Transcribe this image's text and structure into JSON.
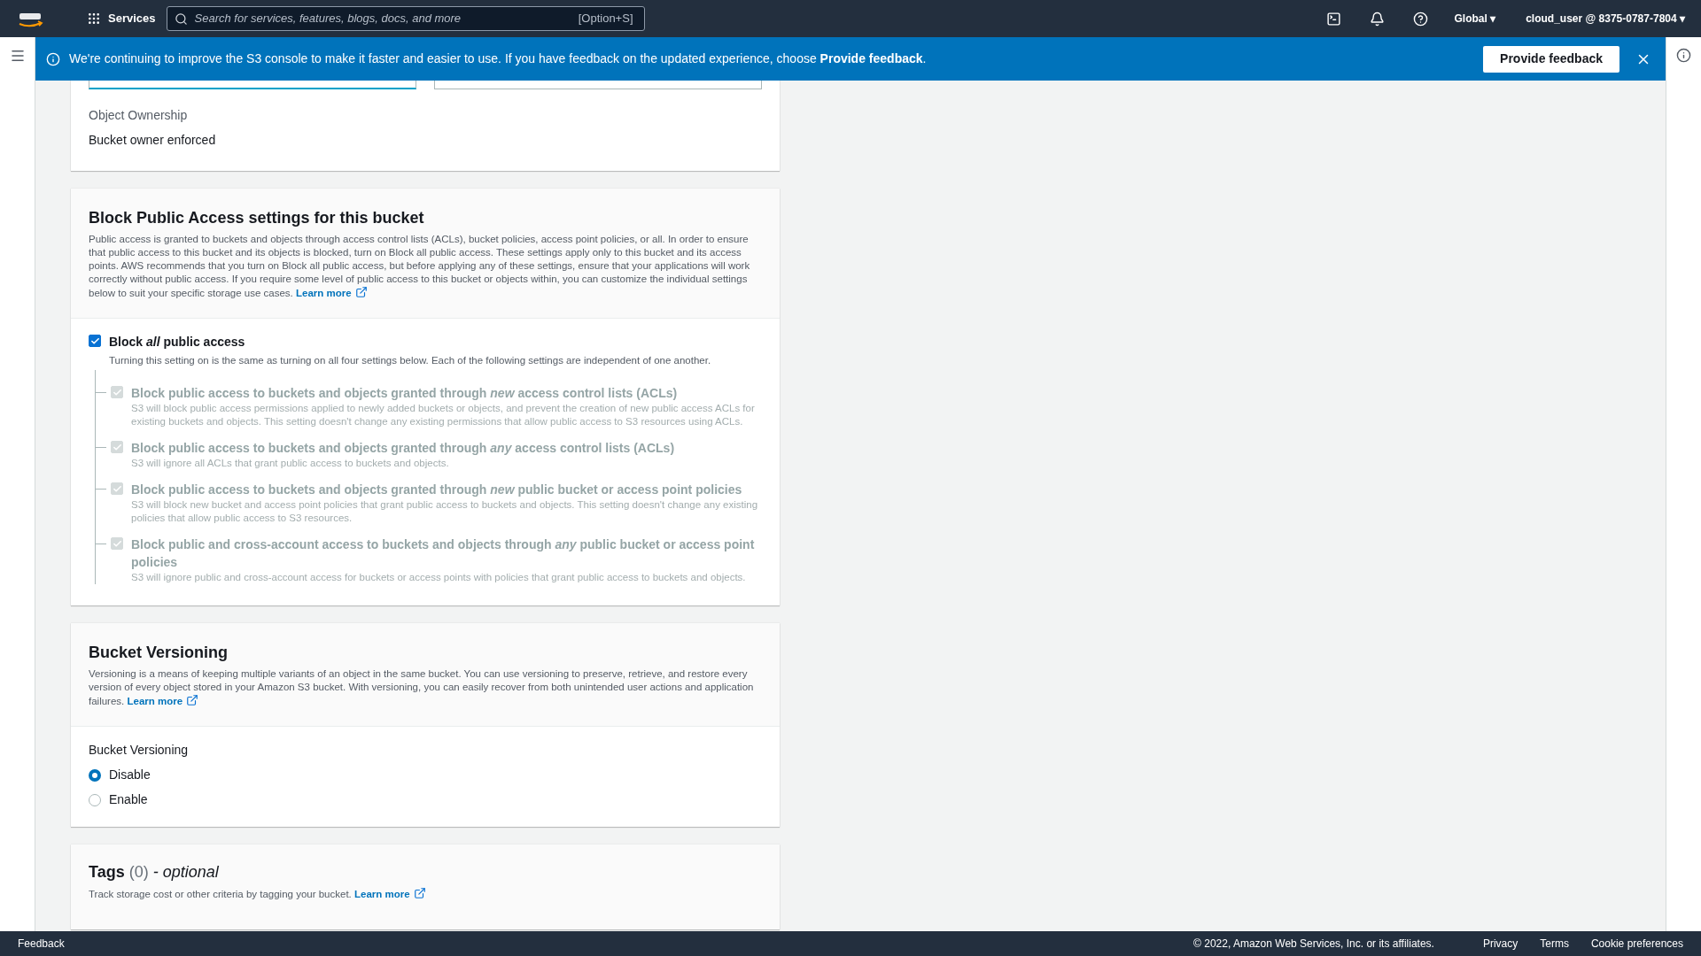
{
  "top_nav": {
    "services": "Services",
    "search": {
      "placeholder": "Search for services, features, blogs, docs, and more",
      "shortcut": "[Option+S]"
    },
    "region": "Global ▾",
    "account": "cloud_user @ 8375-0787-7804 ▾"
  },
  "banner": {
    "text": "We're continuing to improve the S3 console to make it faster and easier to use. If you have feedback on the updated experience, choose **Provide feedback**.",
    "button": "Provide feedback"
  },
  "ownership": {
    "label": "Object Ownership",
    "value": "Bucket owner enforced"
  },
  "block_public_access": {
    "title": "Block Public Access settings for this bucket",
    "description": "Public access is granted to buckets and objects through access control lists (ACLs), bucket policies, access point policies, or all. In order to ensure that public access to this bucket and its objects is blocked, turn on Block all public access. These settings apply only to this bucket and its access points. AWS recommends that you turn on Block all public access, but before applying any of these settings, ensure that your applications will work correctly without public access. If you require some level of public access to this bucket or objects within, you can customize the individual settings below to suit your specific storage use cases.",
    "learn_more": "Learn more",
    "main": {
      "label": "Block *all* public access",
      "hint": "Turning this setting on is the same as turning on all four settings below. Each of the following settings are independent of one another.",
      "checked": true
    },
    "settings": [
      {
        "label": "Block public access to buckets and objects granted through *new* access control lists (ACLs)",
        "hint": "S3 will block public access permissions applied to newly added buckets or objects, and prevent the creation of new public access ACLs for existing buckets and objects. This setting doesn't change any existing permissions that allow public access to S3 resources using ACLs.",
        "checked": true,
        "disabled": true
      },
      {
        "label": "Block public access to buckets and objects granted through *any* access control lists (ACLs)",
        "hint": "S3 will ignore all ACLs that grant public access to buckets and objects.",
        "checked": true,
        "disabled": true
      },
      {
        "label": "Block public access to buckets and objects granted through *new* public bucket or access point policies",
        "hint": "S3 will block new bucket and access point policies that grant public access to buckets and objects. This setting doesn't change any existing policies that allow public access to S3 resources.",
        "checked": true,
        "disabled": true
      },
      {
        "label": "Block public and cross-account access to buckets and objects through *any* public bucket or access point policies",
        "hint": "S3 will ignore public and cross-account access for buckets or access points with policies that grant public access to buckets and objects.",
        "checked": true,
        "disabled": true
      }
    ]
  },
  "versioning": {
    "title": "Bucket Versioning",
    "description": "Versioning is a means of keeping multiple variants of an object in the same bucket. You can use versioning to preserve, retrieve, and restore every version of every object stored in your Amazon S3 bucket. With versioning, you can easily recover from both unintended user actions and application failures.",
    "learn_more": "Learn more",
    "label": "Bucket Versioning",
    "options": [
      {
        "label": "Disable",
        "selected": true
      },
      {
        "label": "Enable",
        "selected": false
      }
    ]
  },
  "tags": {
    "title": "Tags",
    "count": "(0)",
    "optional": "- optional",
    "description": "Track storage cost or other criteria by tagging your bucket.",
    "learn_more": "Learn more"
  },
  "footer": {
    "feedback": "Feedback",
    "copyright": "© 2022, Amazon Web Services, Inc. or its affiliates.",
    "links": [
      "Privacy",
      "Terms",
      "Cookie preferences"
    ]
  }
}
